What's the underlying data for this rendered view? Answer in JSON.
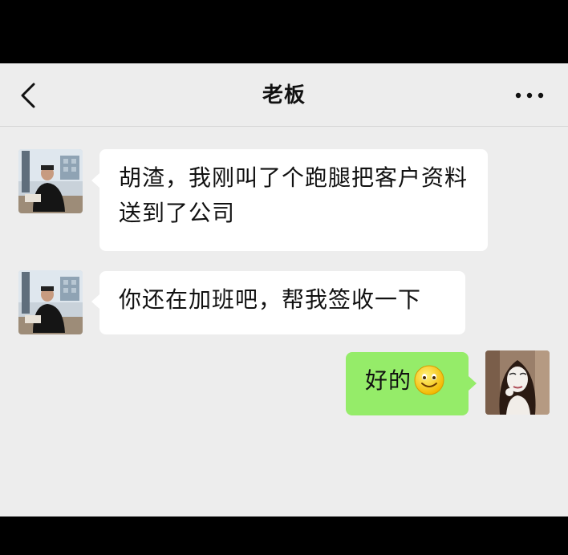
{
  "header": {
    "title": "老板",
    "back_icon": "chevron-left-icon",
    "more_icon": "more-dots-icon"
  },
  "messages": [
    {
      "sender": "boss",
      "side": "left",
      "text": "胡渣，我刚叫了个跑腿把客户资料送到了公司"
    },
    {
      "sender": "boss",
      "side": "left",
      "text": "你还在加班吧，帮我签收一下"
    },
    {
      "sender": "me",
      "side": "right",
      "text": "好的",
      "emoji": "smile-emoji-icon"
    }
  ],
  "colors": {
    "chat_background": "#ededed",
    "incoming_bubble": "#ffffff",
    "outgoing_bubble": "#95ec69",
    "frame": "#000000"
  }
}
